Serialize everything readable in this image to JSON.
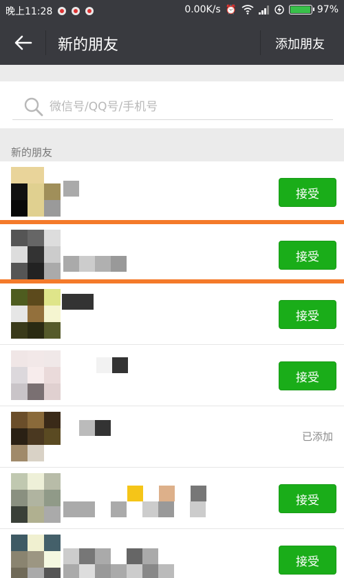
{
  "status_bar": {
    "time": "晚上11:28",
    "net_speed": "0.00K/s",
    "battery_percent": "97%",
    "battery_level": 0.97
  },
  "header": {
    "title": "新的朋友",
    "add_friend_label": "添加朋友"
  },
  "search": {
    "placeholder": "微信号/QQ号/手机号"
  },
  "section": {
    "label": "新的朋友"
  },
  "requests": [
    {
      "status": "pending",
      "action_label": "接受"
    },
    {
      "status": "pending",
      "action_label": "接受"
    },
    {
      "status": "pending",
      "action_label": "接受"
    },
    {
      "status": "pending",
      "action_label": "接受"
    },
    {
      "status": "added",
      "status_label": "已添加"
    },
    {
      "status": "pending",
      "action_label": "接受"
    },
    {
      "status": "pending",
      "action_label": "接受"
    }
  ],
  "colors": {
    "header_bg": "#393a3f",
    "accent_green": "#1aad19",
    "highlight_orange": "#f47a2a",
    "divider_gray": "#ebebeb"
  }
}
